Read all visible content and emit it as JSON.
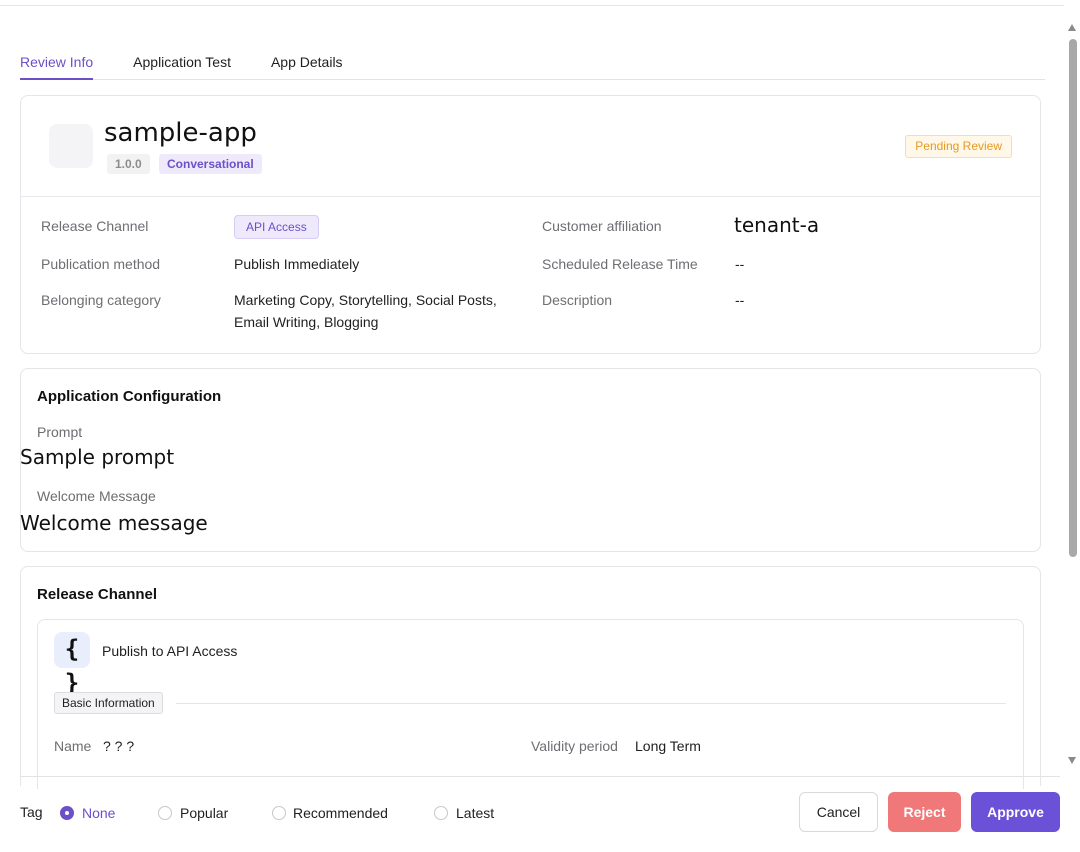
{
  "tabs": [
    {
      "label": "Review Info",
      "active": true
    },
    {
      "label": "Application Test",
      "active": false
    },
    {
      "label": "App Details",
      "active": false
    }
  ],
  "app": {
    "name": "sample-app",
    "version": "1.0.0",
    "type": "Conversational",
    "status": "Pending Review"
  },
  "info": {
    "release_channel_label": "Release Channel",
    "release_channel_value": "API Access",
    "publication_method_label": "Publication method",
    "publication_method_value": "Publish Immediately",
    "category_label": "Belonging category",
    "category_value_line1": "Marketing Copy, Storytelling, Social Posts,",
    "category_value_line2": "Email Writing, Blogging",
    "customer_label": "Customer affiliation",
    "customer_value": "tenant-a",
    "scheduled_label": "Scheduled Release Time",
    "scheduled_value": "--",
    "description_label": "Description",
    "description_value": "--"
  },
  "config": {
    "title": "Application Configuration",
    "prompt_label": "Prompt",
    "prompt_value": "Sample prompt",
    "welcome_label": "Welcome Message",
    "welcome_value": "Welcome message"
  },
  "release": {
    "title": "Release Channel",
    "publish_label": "Publish to API Access",
    "api_icon_glyph": "{ }",
    "basic_info_tag": "Basic Information",
    "name_label": "Name",
    "name_value": "? ? ?",
    "validity_label": "Validity period",
    "validity_value": "Long Term"
  },
  "footer": {
    "tag_label": "Tag",
    "options": [
      {
        "label": "None",
        "checked": true
      },
      {
        "label": "Popular",
        "checked": false
      },
      {
        "label": "Recommended",
        "checked": false
      },
      {
        "label": "Latest",
        "checked": false
      }
    ],
    "cancel_label": "Cancel",
    "reject_label": "Reject",
    "approve_label": "Approve"
  },
  "colors": {
    "accent": "#6b50c8",
    "reject": "#f07878",
    "approve": "#6b50d8",
    "pending": "#e69a23"
  }
}
